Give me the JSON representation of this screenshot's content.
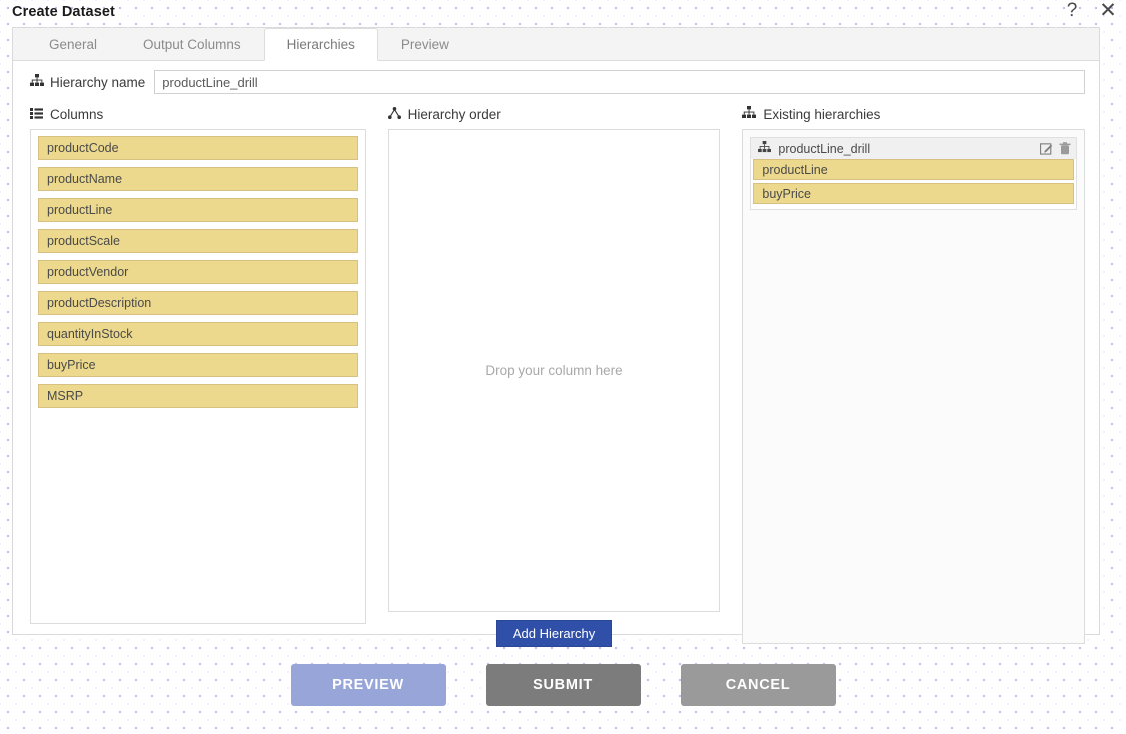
{
  "window": {
    "title": "Create Dataset",
    "help_icon": "question-mark-icon",
    "close_icon": "close-icon"
  },
  "tabs": [
    {
      "label": "General",
      "active": false
    },
    {
      "label": "Output Columns",
      "active": false
    },
    {
      "label": "Hierarchies",
      "active": true
    },
    {
      "label": "Preview",
      "active": false
    }
  ],
  "hierarchy_name": {
    "label": "Hierarchy name",
    "icon": "sitemap-icon",
    "value": "productLine_drill",
    "placeholder": ""
  },
  "columns_panel": {
    "title": "Columns",
    "icon": "list-icon",
    "items": [
      "productCode",
      "productName",
      "productLine",
      "productScale",
      "productVendor",
      "productDescription",
      "quantityInStock",
      "buyPrice",
      "MSRP"
    ]
  },
  "order_panel": {
    "title": "Hierarchy order",
    "icon": "hierarchy-icon",
    "drop_hint": "Drop your column here",
    "items": [],
    "add_button": "Add Hierarchy"
  },
  "existing_panel": {
    "title": "Existing hierarchies",
    "icon": "sitemap-icon",
    "groups": [
      {
        "name": "productLine_drill",
        "icon": "sitemap-icon",
        "edit_icon": "edit-icon",
        "delete_icon": "trash-icon",
        "items": [
          "productLine",
          "buyPrice"
        ]
      }
    ]
  },
  "footer": {
    "preview_label": "PREVIEW",
    "submit_label": "SUBMIT",
    "cancel_label": "CANCEL"
  },
  "colors": {
    "chip_bg": "#ecd98d",
    "chip_border": "#d6c183",
    "add_button_bg": "#2f4fa8",
    "preview_bg": "#97a5d8",
    "submit_bg": "#7c7c7c",
    "cancel_bg": "#9a9a9a",
    "dot_pattern": "#b9c0e8"
  }
}
